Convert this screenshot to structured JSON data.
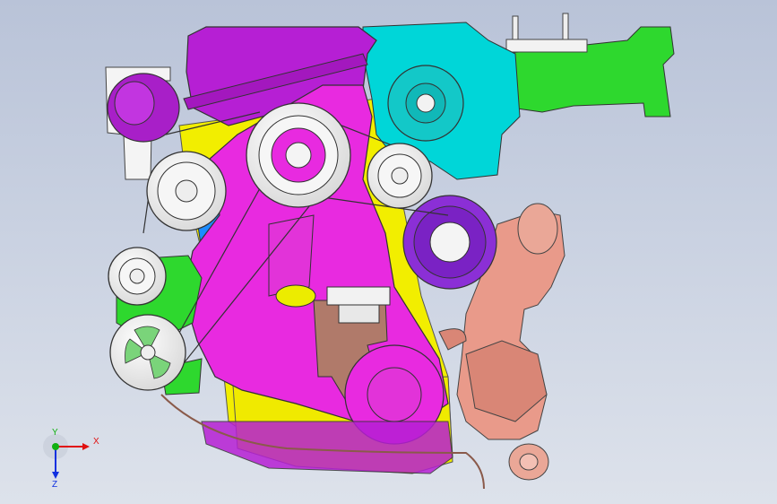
{
  "viewport": {
    "background_top": "#b9c3d8",
    "background_bottom": "#dde2eb"
  },
  "model": {
    "type": "engine-assembly",
    "colors": {
      "valve_cover": "#b61fd4",
      "timing_cover": "#e82ae0",
      "engine_block": "#f2ee00",
      "water_pump_housing": "#00d6d8",
      "bracket": "#2ed82e",
      "turbo_exhaust": "#e99a8a",
      "cam_gear": "#8b2fd6",
      "blue_part": "#1c8cff",
      "belt_pulleys": "#f4f4f4"
    }
  },
  "triad": {
    "x_label": "X",
    "y_label": "Y",
    "z_label": "Z",
    "x_color": "#e01010",
    "y_color": "#10b010",
    "z_color": "#1030e0"
  }
}
